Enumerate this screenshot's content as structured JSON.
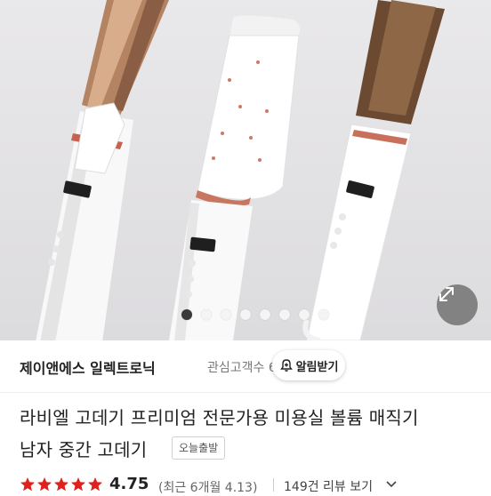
{
  "gallery": {
    "dot_count": 8,
    "active_index": 0,
    "expand_icon": "expand-arrows-icon"
  },
  "seller": {
    "name": "제이앤에스 일렉트로닉",
    "visitor_label": "관심고객수 646",
    "notify_label": "알림받기",
    "notify_icon": "bell-plus-icon"
  },
  "product": {
    "title_line1": "라비엘 고데기 프리미엄 전문가용 미용실 볼륨 매직기",
    "title_line2": "남자 중간 고데기",
    "badge": "오늘출발"
  },
  "rating": {
    "stars": 5,
    "value": "4.75",
    "recent": "(최근 6개월 4.13)",
    "reviews": "149건 리뷰 보기",
    "star_color": "#e0201c"
  }
}
